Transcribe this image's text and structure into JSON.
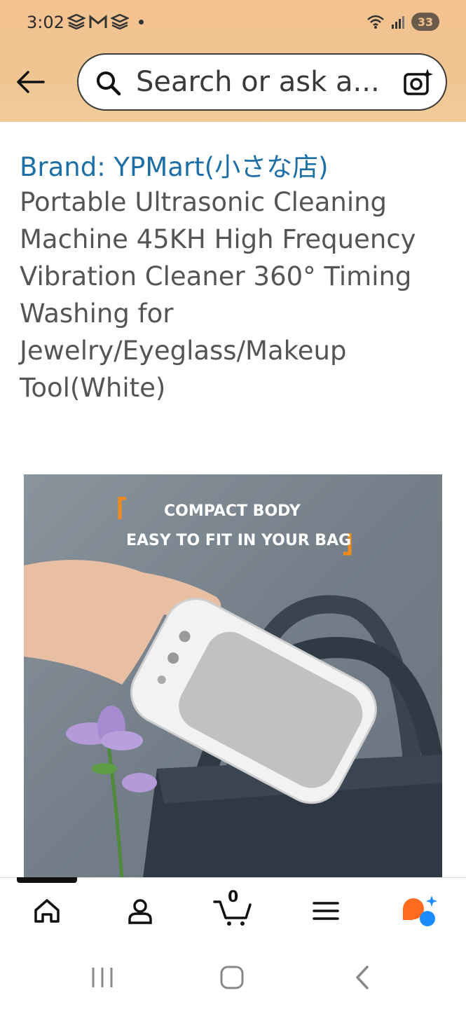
{
  "status_bar": {
    "time": "3:02",
    "battery": "33"
  },
  "search": {
    "placeholder": "Search or ask a..."
  },
  "product": {
    "brand": "Brand: YPMart(小さな店)",
    "title": "Portable Ultrasonic Cleaning Machine 45KH High Frequency Vibration Cleaner 360° Timing Washing for Jewelry/Eyeglass/Makeup Tool(White)",
    "image_caption_line1": "COMPACT BODY",
    "image_caption_line2": "EASY TO FIT IN YOUR BAG"
  },
  "bottom_nav": {
    "items": [
      "home-icon",
      "account-icon",
      "cart-icon",
      "menu-icon",
      "rufus-icon"
    ],
    "cart_count": "0"
  },
  "colors": {
    "header": "#f3c28f",
    "brand_link": "#1d6fa5",
    "accent": "#ff7a1a"
  }
}
